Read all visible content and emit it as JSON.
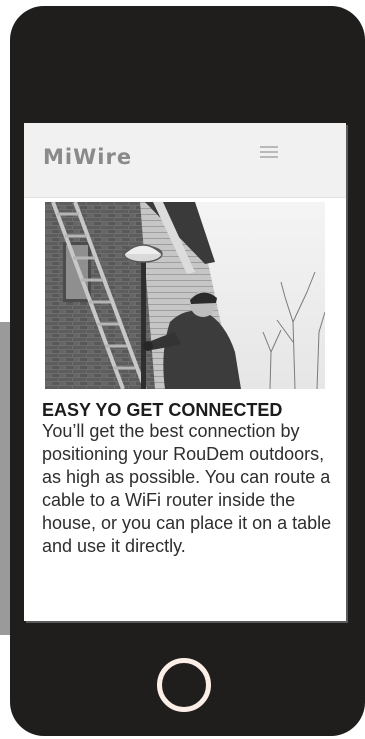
{
  "header": {
    "logo_text": "MiWire",
    "menu_icon": "hamburger-menu-icon"
  },
  "hero": {
    "image": "photo of a man on a ladder mounting a device on a pole at a house"
  },
  "content": {
    "headline": "EASY YO GET CONNECTED",
    "body": "You’ll get the best connection by positioning your RouDem outdoors, as high as possible. You can route a cable to a WiFi router inside the house, or you can place it on a table and use it directly."
  },
  "device": {
    "home_button_icon": "home-button-ring-icon",
    "frame_color": "#1f1e1c",
    "home_ring_color": "#fbeee6"
  }
}
